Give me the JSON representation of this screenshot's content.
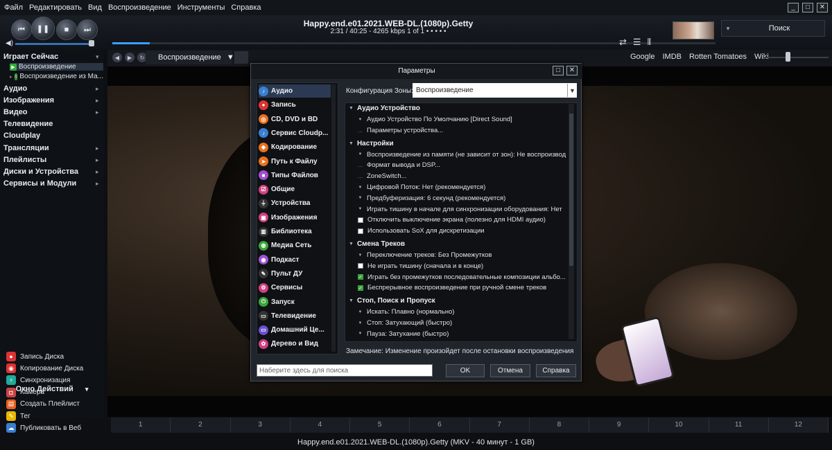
{
  "menu": [
    "Файл",
    "Редактировать",
    "Вид",
    "Воспроизведение",
    "Инструменты",
    "Справка"
  ],
  "window_controls": {
    "minimize": "_",
    "maximize": "□",
    "close": "✕"
  },
  "transport": {
    "prev": "⏮",
    "pause": "❚❚",
    "stop": "■",
    "next": "⏭"
  },
  "now": {
    "title": "Happy.end.e01.2021.WEB-DL.(1080p).Getty",
    "subtitle": "2:31 / 40:25 - 4265 kbps   1 of 1   •  •  •  •  •"
  },
  "seek_progress": 0.062,
  "volume_level": 0.95,
  "search": {
    "label": "Поиск"
  },
  "row_icons": [
    "⇄",
    "☰",
    "⫴"
  ],
  "view": {
    "selected": "Воспроизведение"
  },
  "links": [
    "Google",
    "IMDB",
    "Rotten Tomatoes",
    "Wiki"
  ],
  "sidebar": {
    "sections": [
      {
        "label": "Играет Сейчас",
        "chev": "▾"
      },
      {
        "label": "Аудио",
        "chev": "▸"
      },
      {
        "label": "Изображения",
        "chev": "▸"
      },
      {
        "label": "Видео",
        "chev": "▸"
      },
      {
        "label": "Телевидение",
        "chev": ""
      },
      {
        "label": "Cloudplay",
        "chev": ""
      },
      {
        "label": "Трансляции",
        "chev": "▸"
      },
      {
        "label": "Плейлисты",
        "chev": "▸"
      },
      {
        "label": "Диски и Устройства",
        "chev": "▸"
      },
      {
        "label": "Сервисы и Модули",
        "chev": "▸"
      }
    ],
    "sub1": "Воспроизведение",
    "sub2": "Воспроизведение из Ма...",
    "actions_title": "Окно Действий",
    "actions": [
      "Запись Диска",
      "Копирование Диска",
      "Синхронизация",
      "Камера",
      "Создать Плейлист",
      "Тег",
      "Публиковать в Веб"
    ]
  },
  "tracks": [
    "1",
    "2",
    "3",
    "4",
    "5",
    "6",
    "7",
    "8",
    "9",
    "10",
    "11",
    "12"
  ],
  "status": "Happy.end.e01.2021.WEB-DL.(1080p).Getty (MKV - 40 минут - 1 GB)",
  "dialog": {
    "title": "Параметры",
    "categories": [
      "Аудио",
      "Запись",
      "CD, DVD и BD",
      "Сервис Cloudp...",
      "Кодирование",
      "Путь к Файлу",
      "Типы Файлов",
      "Общие",
      "Устройства",
      "Изображения",
      "Библиотека",
      "Медиа Сеть",
      "Подкаст",
      "Пульт ДУ",
      "Сервисы",
      "Запуск",
      "Телевидение",
      "Домашний Це...",
      "Дерево и Вид"
    ],
    "zone_label": "Конфигурация Зоны:",
    "zone_value": "Воспроизведение",
    "groups": [
      {
        "label": "Аудио Устройство",
        "items": [
          {
            "t": "Аудио Устройство По Умолчанию [Direct Sound]",
            "m": "tri"
          },
          {
            "t": "Параметры устройства...",
            "m": "dot"
          }
        ]
      },
      {
        "label": "Настройки",
        "items": [
          {
            "t": "Воспроизведение из памяти (не зависит от зон): Не воспроизвод...",
            "m": "tri"
          },
          {
            "t": "Формат вывода и DSP...",
            "m": "dot"
          },
          {
            "t": "ZoneSwitch...",
            "m": "dot"
          },
          {
            "t": "Цифровой Поток: Нет (рекомендуется)",
            "m": "tri"
          },
          {
            "t": "Предбуферизация: 6 секунд (рекомендуется)",
            "m": "tri"
          },
          {
            "t": "Играть тишину в начале для синхронизации оборудования: Нет",
            "m": "tri"
          },
          {
            "t": "Отключить выключение экрана (полезно для HDMI аудио)",
            "m": "off"
          },
          {
            "t": "Использовать SoX для дискретизации",
            "m": "off"
          }
        ]
      },
      {
        "label": "Смена Треков",
        "items": [
          {
            "t": "Переключение треков: Без Промежутков",
            "m": "tri"
          },
          {
            "t": "Не играть тишину (сначала и в конце)",
            "m": "off"
          },
          {
            "t": "Играть без промежутков последовательные композиции альбо...",
            "m": "on"
          },
          {
            "t": "Беспрерывное воспроизведение при ручной смене треков",
            "m": "on"
          }
        ]
      },
      {
        "label": "Стоп, Поиск и Пропуск",
        "items": [
          {
            "t": "Искать: Плавно (нормально)",
            "m": "tri"
          },
          {
            "t": "Стоп: Затухающий (быстро)",
            "m": "tri"
          },
          {
            "t": "Пауза: Затухание (быстро)",
            "m": "tri"
          }
        ]
      }
    ],
    "note": "Замечание: Изменение произойдет после остановки воспроизведения",
    "search_placeholder": "Наберите здесь для поиска",
    "ok": "OK",
    "cancel": "Отмена",
    "help": "Справка"
  },
  "colors": {
    "accent": "#3aa0ff",
    "check": "#3aa43a",
    "selected": "#2b3a52"
  }
}
